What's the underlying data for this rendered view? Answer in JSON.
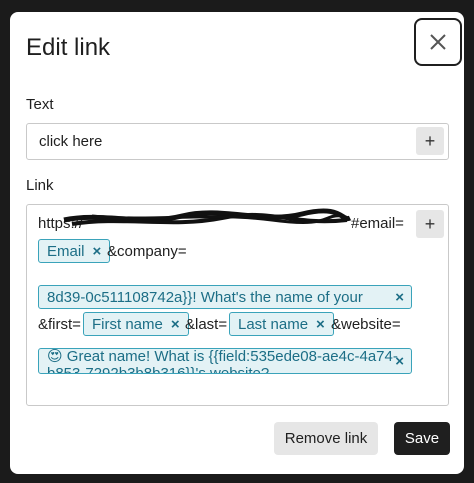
{
  "dialog": {
    "title": "Edit link",
    "close_icon": "close-icon"
  },
  "text_field": {
    "label": "Text",
    "value": "click here",
    "add_button": "+"
  },
  "link_field": {
    "label": "Link",
    "add_button": "+",
    "segments": {
      "url_prefix": "https://",
      "url_suffix": "#email=",
      "company_param": "&company=",
      "first_param": "&first=",
      "last_param": "&last=",
      "website_param": "&website="
    },
    "chips": {
      "email": "Email",
      "question": "8d39-0c511108742a}}! What's the name of your",
      "first_name": "First name",
      "last_name": "Last name",
      "great_name": "😍 Great name! What is {{field:535ede08-ae4c-4a74-b853-7292b3b8b316}}'s website?"
    },
    "chip_remove": "×"
  },
  "footer": {
    "remove_label": "Remove link",
    "save_label": "Save"
  },
  "colors": {
    "chip_bg": "#e3f2f5",
    "chip_border": "#3aa3ba",
    "chip_text": "#1c6e86",
    "save_bg": "#1f1f1f"
  }
}
